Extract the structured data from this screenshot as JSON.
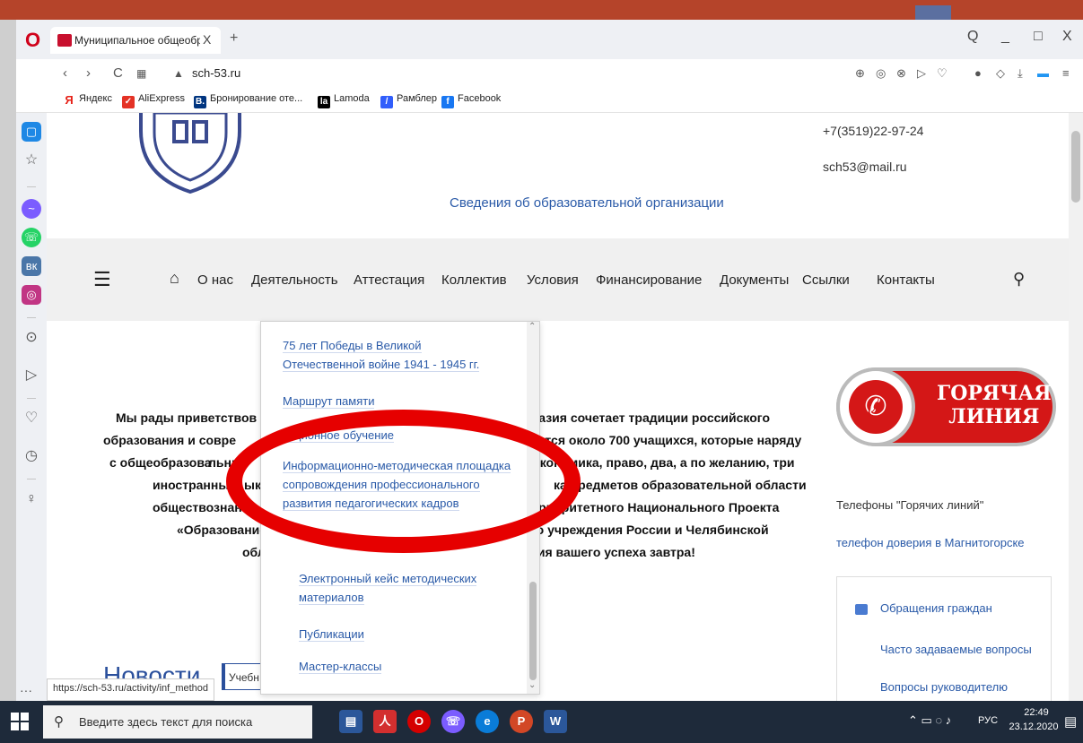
{
  "browser": {
    "tab_title": "Муниципальное общеобр",
    "tab_close": "X",
    "tab_new": "+",
    "url": "sch-53.ru",
    "window_controls": [
      "Q",
      "_",
      "□",
      "X"
    ]
  },
  "bookmarks": [
    {
      "label": "Яндекс",
      "icon": "Я",
      "color": "#e62117"
    },
    {
      "label": "AliExpress",
      "icon": "✓",
      "color": "#e43225"
    },
    {
      "label": "Бронирование оте...",
      "icon": "B.",
      "color": "#003580"
    },
    {
      "label": "Lamoda",
      "icon": "la",
      "color": "#000000"
    },
    {
      "label": "Рамблер",
      "icon": "/",
      "color": "#315efb"
    },
    {
      "label": "Facebook",
      "icon": "f",
      "color": "#1877f2"
    }
  ],
  "header": {
    "phone": "+7(3519)22-97-24",
    "email": "sch53@mail.ru",
    "org_info_link": "Сведения об образовательной организации"
  },
  "nav": {
    "items": [
      "О нас",
      "Деятельность",
      "Аттестация",
      "Коллектив",
      "Условия",
      "Финансирование",
      "Документы",
      "Ссылки",
      "Контакты"
    ]
  },
  "dropdown": {
    "items": [
      "75 лет Победы в Великой Отечественной войне 1941 - 1945 гг.",
      "Маршрут памяти",
      "…ционное обучение",
      "Информационно-методическая площадка сопровождения профессионального развития педагогических кадров",
      "Электронный кейс методических материалов",
      "Публикации",
      "Мастер-классы"
    ]
  },
  "welcome": {
    "lines": [
      "Мы рады приветствов",
      "гимназия сочетает традиции российского",
      "образования и совре",
      "ается около 700 учащихся, которые наряду",
      "с общеобразова",
      "льны",
      "экономика, право, два, а по желанию, три",
      "иностранных",
      "ыка. Т",
      "ка предметов образовательной области",
      "обществознание. Н",
      "Приоритетного Национального Проекта",
      "«Образование» в",
      "го учреждения России и Челябинской",
      "област",
      "тия вашего успеха завтра!"
    ]
  },
  "news": {
    "title": "Новости",
    "tab": "Учебн"
  },
  "hotline": {
    "line1": "ГОРЯЧАЯ",
    "line2": "ЛИНИЯ"
  },
  "sidebar_right": {
    "hotlines_label": "Телефоны \"Горячих линий\"",
    "trust_link": "телефон доверия в Магнитогорске",
    "links": [
      "Обращения граждан",
      "Часто задаваемые вопросы",
      "Вопросы руководителю"
    ]
  },
  "status_url": "https://sch-53.ru/activity/inf_method",
  "taskbar": {
    "search_placeholder": "Введите здесь текст для поиска",
    "lang": "РУС",
    "time": "22:49",
    "date": "23.12.2020"
  },
  "colors": {
    "link": "#2a5aa8",
    "annotation_red": "#e60000",
    "hotline_red": "#d41717"
  }
}
